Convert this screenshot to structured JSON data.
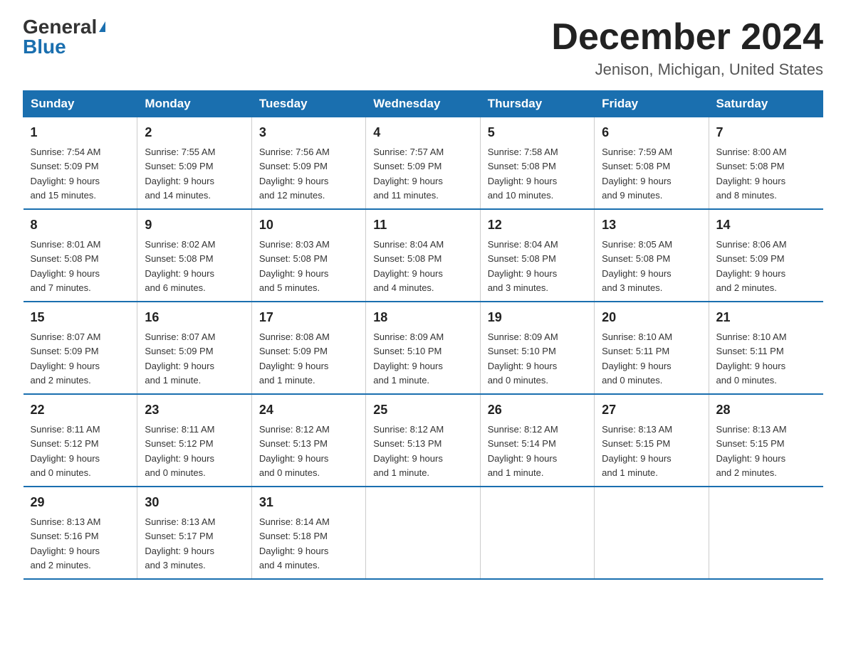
{
  "logo": {
    "general": "General",
    "blue": "Blue"
  },
  "title": "December 2024",
  "location": "Jenison, Michigan, United States",
  "days_of_week": [
    "Sunday",
    "Monday",
    "Tuesday",
    "Wednesday",
    "Thursday",
    "Friday",
    "Saturday"
  ],
  "weeks": [
    [
      {
        "day": "1",
        "sunrise": "7:54 AM",
        "sunset": "5:09 PM",
        "daylight": "9 hours and 15 minutes."
      },
      {
        "day": "2",
        "sunrise": "7:55 AM",
        "sunset": "5:09 PM",
        "daylight": "9 hours and 14 minutes."
      },
      {
        "day": "3",
        "sunrise": "7:56 AM",
        "sunset": "5:09 PM",
        "daylight": "9 hours and 12 minutes."
      },
      {
        "day": "4",
        "sunrise": "7:57 AM",
        "sunset": "5:09 PM",
        "daylight": "9 hours and 11 minutes."
      },
      {
        "day": "5",
        "sunrise": "7:58 AM",
        "sunset": "5:08 PM",
        "daylight": "9 hours and 10 minutes."
      },
      {
        "day": "6",
        "sunrise": "7:59 AM",
        "sunset": "5:08 PM",
        "daylight": "9 hours and 9 minutes."
      },
      {
        "day": "7",
        "sunrise": "8:00 AM",
        "sunset": "5:08 PM",
        "daylight": "9 hours and 8 minutes."
      }
    ],
    [
      {
        "day": "8",
        "sunrise": "8:01 AM",
        "sunset": "5:08 PM",
        "daylight": "9 hours and 7 minutes."
      },
      {
        "day": "9",
        "sunrise": "8:02 AM",
        "sunset": "5:08 PM",
        "daylight": "9 hours and 6 minutes."
      },
      {
        "day": "10",
        "sunrise": "8:03 AM",
        "sunset": "5:08 PM",
        "daylight": "9 hours and 5 minutes."
      },
      {
        "day": "11",
        "sunrise": "8:04 AM",
        "sunset": "5:08 PM",
        "daylight": "9 hours and 4 minutes."
      },
      {
        "day": "12",
        "sunrise": "8:04 AM",
        "sunset": "5:08 PM",
        "daylight": "9 hours and 3 minutes."
      },
      {
        "day": "13",
        "sunrise": "8:05 AM",
        "sunset": "5:08 PM",
        "daylight": "9 hours and 3 minutes."
      },
      {
        "day": "14",
        "sunrise": "8:06 AM",
        "sunset": "5:09 PM",
        "daylight": "9 hours and 2 minutes."
      }
    ],
    [
      {
        "day": "15",
        "sunrise": "8:07 AM",
        "sunset": "5:09 PM",
        "daylight": "9 hours and 2 minutes."
      },
      {
        "day": "16",
        "sunrise": "8:07 AM",
        "sunset": "5:09 PM",
        "daylight": "9 hours and 1 minute."
      },
      {
        "day": "17",
        "sunrise": "8:08 AM",
        "sunset": "5:09 PM",
        "daylight": "9 hours and 1 minute."
      },
      {
        "day": "18",
        "sunrise": "8:09 AM",
        "sunset": "5:10 PM",
        "daylight": "9 hours and 1 minute."
      },
      {
        "day": "19",
        "sunrise": "8:09 AM",
        "sunset": "5:10 PM",
        "daylight": "9 hours and 0 minutes."
      },
      {
        "day": "20",
        "sunrise": "8:10 AM",
        "sunset": "5:11 PM",
        "daylight": "9 hours and 0 minutes."
      },
      {
        "day": "21",
        "sunrise": "8:10 AM",
        "sunset": "5:11 PM",
        "daylight": "9 hours and 0 minutes."
      }
    ],
    [
      {
        "day": "22",
        "sunrise": "8:11 AM",
        "sunset": "5:12 PM",
        "daylight": "9 hours and 0 minutes."
      },
      {
        "day": "23",
        "sunrise": "8:11 AM",
        "sunset": "5:12 PM",
        "daylight": "9 hours and 0 minutes."
      },
      {
        "day": "24",
        "sunrise": "8:12 AM",
        "sunset": "5:13 PM",
        "daylight": "9 hours and 0 minutes."
      },
      {
        "day": "25",
        "sunrise": "8:12 AM",
        "sunset": "5:13 PM",
        "daylight": "9 hours and 1 minute."
      },
      {
        "day": "26",
        "sunrise": "8:12 AM",
        "sunset": "5:14 PM",
        "daylight": "9 hours and 1 minute."
      },
      {
        "day": "27",
        "sunrise": "8:13 AM",
        "sunset": "5:15 PM",
        "daylight": "9 hours and 1 minute."
      },
      {
        "day": "28",
        "sunrise": "8:13 AM",
        "sunset": "5:15 PM",
        "daylight": "9 hours and 2 minutes."
      }
    ],
    [
      {
        "day": "29",
        "sunrise": "8:13 AM",
        "sunset": "5:16 PM",
        "daylight": "9 hours and 2 minutes."
      },
      {
        "day": "30",
        "sunrise": "8:13 AM",
        "sunset": "5:17 PM",
        "daylight": "9 hours and 3 minutes."
      },
      {
        "day": "31",
        "sunrise": "8:14 AM",
        "sunset": "5:18 PM",
        "daylight": "9 hours and 4 minutes."
      },
      null,
      null,
      null,
      null
    ]
  ],
  "labels": {
    "sunrise": "Sunrise:",
    "sunset": "Sunset:",
    "daylight": "Daylight:"
  }
}
